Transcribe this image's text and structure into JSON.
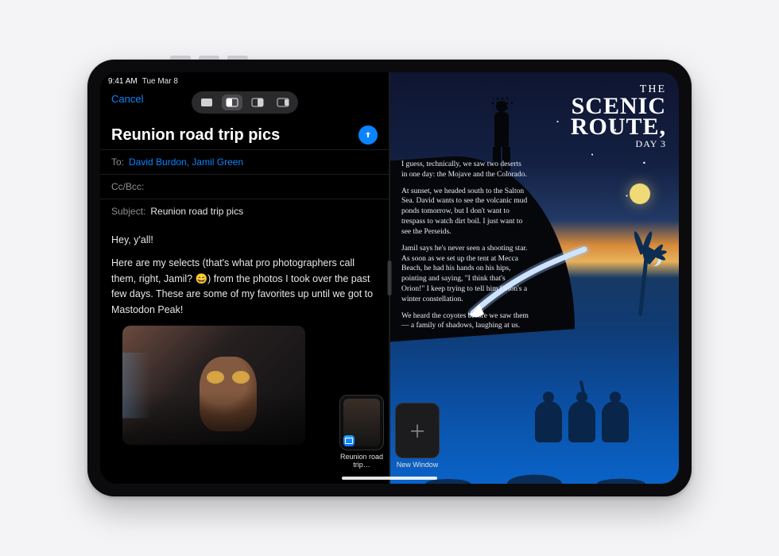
{
  "status": {
    "time": "9:41 AM",
    "date": "Tue Mar 8"
  },
  "multitask": {
    "options": [
      "fullscreen",
      "split-left",
      "split-right",
      "slideover"
    ],
    "active_index": 1
  },
  "mail": {
    "cancel": "Cancel",
    "title": "Reunion road trip pics",
    "to_label": "To:",
    "to_recipients": [
      "David Burdon",
      "Jamil Green"
    ],
    "ccbcc_label": "Cc/Bcc:",
    "subject_label": "Subject:",
    "subject_value": "Reunion road trip pics",
    "body_greeting": "Hey, y'all!",
    "body_main": "Here are my selects (that's what pro photographers call them, right, Jamil? 😄) from the photos I took over the past few days. These are some of my favorites up until we got to Mastodon Peak!"
  },
  "shelf": {
    "items": [
      {
        "kind": "window",
        "label": "Reunion road trip…"
      },
      {
        "kind": "new",
        "label": "New Window"
      }
    ]
  },
  "journal": {
    "title_small": "THE",
    "title_main1": "SCENIC",
    "title_main2": "ROUTE,",
    "title_day": "DAY 3",
    "paragraphs": [
      "I guess, technically, we saw two deserts in one day: the Mojave and the Colorado.",
      "At sunset, we headed south to the Salton Sea. David wants to see the volcanic mud ponds tomorrow, but I don't want to trespass to watch dirt boil. I just want to see the Perseids.",
      "Jamil says he's never seen a shooting star. As soon as we set up the tent at Mecca Beach, he had his hands on his hips, pointing and saying, \"I think that's Orion!\" I keep trying to tell him Orion's a winter constellation.",
      "We heard the coyotes before we saw them — a family of shadows, laughing at us."
    ]
  },
  "colors": {
    "accent": "#0a84ff"
  }
}
